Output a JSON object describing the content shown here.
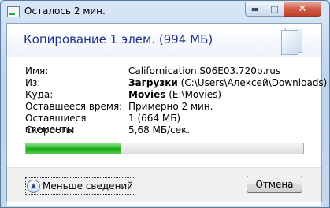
{
  "window": {
    "title": "Осталось 2 мин."
  },
  "header": {
    "title": "Копирование 1 элем. (994 МБ)"
  },
  "details": [
    {
      "label": "Имя:",
      "value": "Californication.S06E03.720p.rus"
    },
    {
      "label": "Из:",
      "bold": "Загрузки",
      "value": " (C:\\Users\\Алексей\\Downloads)"
    },
    {
      "label": "Куда:",
      "bold": "Movies",
      "value": " (E:\\Movies)"
    },
    {
      "label": "Оставшееся время:",
      "value": "Примерно 2 мин."
    },
    {
      "label": "Оставшиеся элементы:",
      "value": "1 (664 МБ)"
    },
    {
      "label": "Скорость:",
      "value": "5,68 МБ/сек."
    }
  ],
  "progress": {
    "fraction": 0.34,
    "color": "#22b22a"
  },
  "footer": {
    "less_details_label": "Меньше сведений",
    "cancel_label": "Отмена"
  },
  "icons": [
    "copy-progress-icon",
    "minimize-icon",
    "maximize-icon",
    "close-icon",
    "document-icon",
    "chevron-up-icon"
  ]
}
